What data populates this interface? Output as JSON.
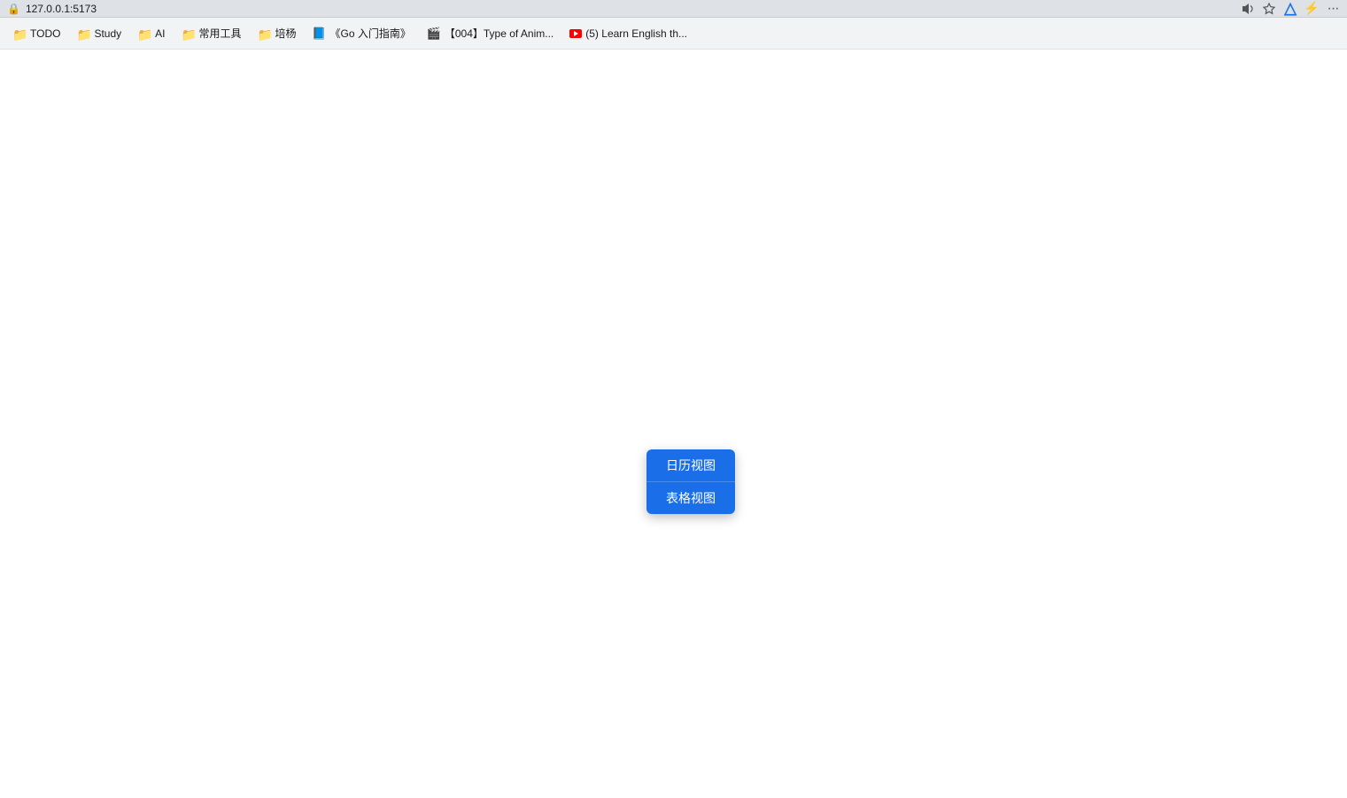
{
  "browser": {
    "address_bar": {
      "url": "127.0.0.1:5173"
    },
    "top_right_icons": {
      "read_aloud": "🔊",
      "favorites": "☆",
      "profile": "△",
      "extensions": "🧩"
    }
  },
  "bookmarks_bar": {
    "items": [
      {
        "id": "todo",
        "type": "folder",
        "label": "TODO"
      },
      {
        "id": "study",
        "type": "folder",
        "label": "Study"
      },
      {
        "id": "ai",
        "type": "folder",
        "label": "AI"
      },
      {
        "id": "changyong",
        "type": "folder",
        "label": "常用工具"
      },
      {
        "id": "yangchang",
        "type": "folder",
        "label": "培杨"
      },
      {
        "id": "go-guide",
        "type": "page",
        "label": "《Go 入门指南》"
      },
      {
        "id": "type-anim",
        "type": "page",
        "label": "【004】Type of Anim..."
      },
      {
        "id": "learn-english",
        "type": "youtube",
        "label": "(5) Learn English th..."
      }
    ]
  },
  "context_menu": {
    "items": [
      {
        "id": "calendar-view",
        "label": "日历视图"
      },
      {
        "id": "table-view",
        "label": "表格视图"
      }
    ]
  }
}
